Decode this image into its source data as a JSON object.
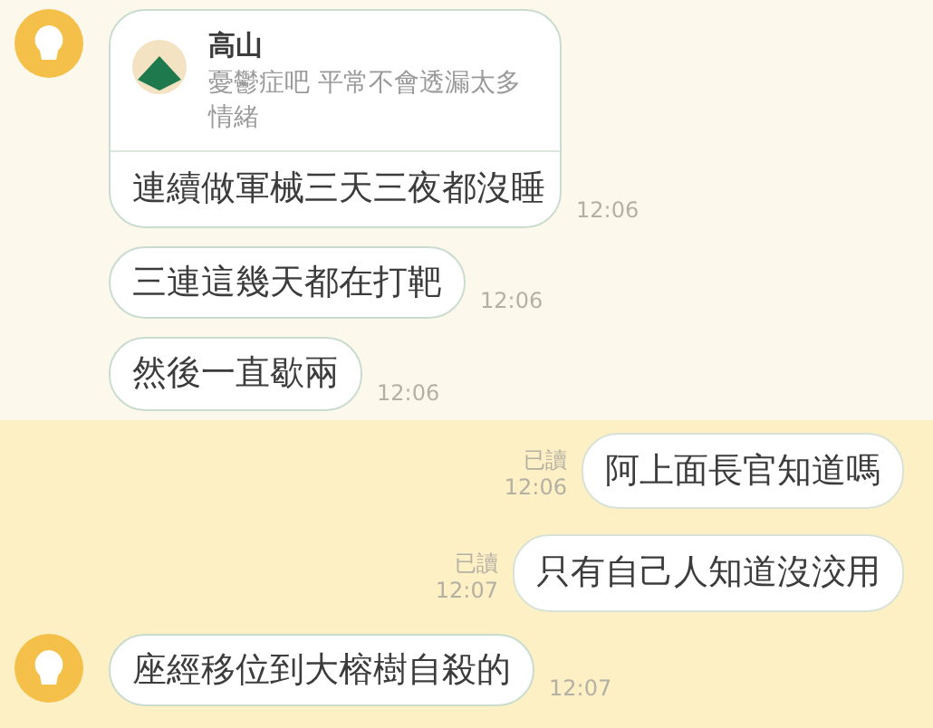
{
  "messages": [
    {
      "kind": "incoming",
      "avatar": true,
      "highlighted": false,
      "reply": {
        "name": "高山",
        "text": "憂鬱症吧 平常不會透漏太多情緒"
      },
      "text": "連續做軍械三天三夜都沒睡",
      "time": "12:06"
    },
    {
      "kind": "incoming",
      "avatar": false,
      "highlighted": false,
      "text": "三連這幾天都在打靶",
      "time": "12:06"
    },
    {
      "kind": "incoming",
      "avatar": false,
      "highlighted": false,
      "text": "然後一直歇兩",
      "time": "12:06"
    },
    {
      "kind": "outgoing",
      "highlighted": true,
      "read": "已讀",
      "text": "阿上面長官知道嗎",
      "time": "12:06"
    },
    {
      "kind": "outgoing",
      "highlighted": true,
      "read": "已讀",
      "text": "只有自己人知道沒洨用",
      "time": "12:07"
    },
    {
      "kind": "incoming",
      "avatar": true,
      "highlighted": true,
      "text": "座經移位到大榕樹自殺的",
      "time": "12:07"
    }
  ]
}
